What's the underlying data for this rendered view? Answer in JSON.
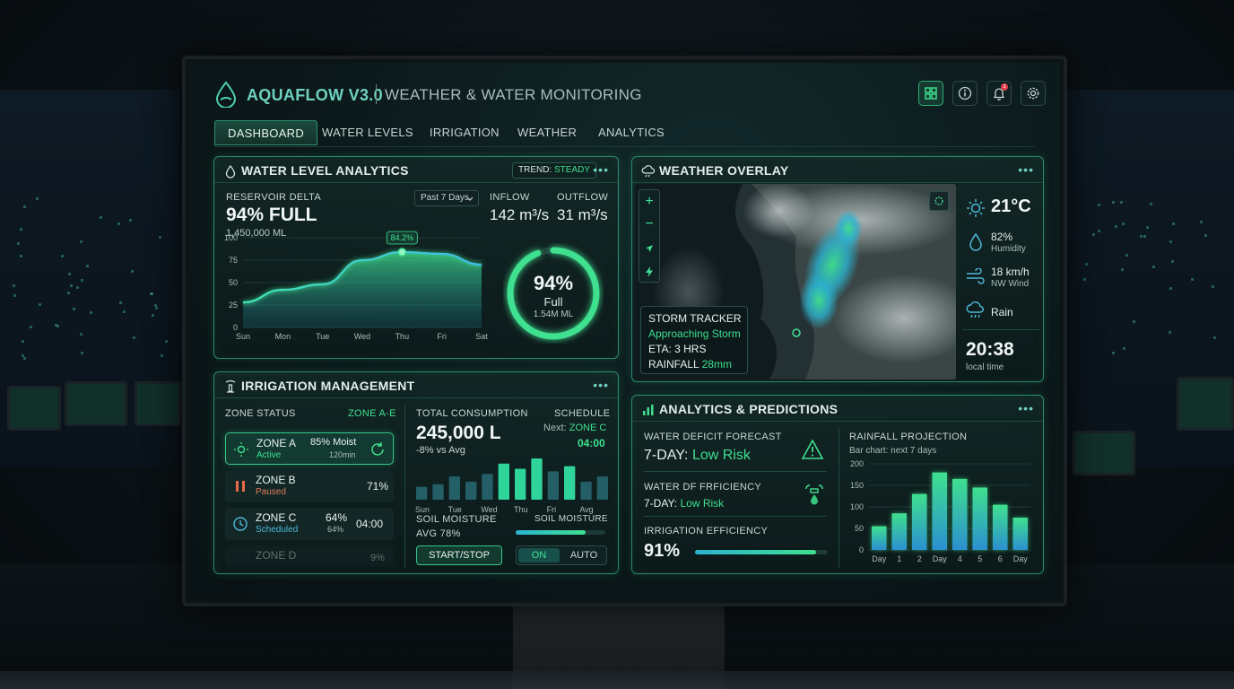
{
  "app": {
    "brand": "AQUAFLOW V3.0",
    "subtitle": "WEATHER & WATER MONITORING"
  },
  "header_buttons": [
    "grid-icon",
    "info-icon",
    "bell-icon",
    "gear-icon"
  ],
  "notification_count": "1",
  "tabs": [
    {
      "label": "DASHBOARD",
      "active": true
    },
    {
      "label": "WATER LEVELS"
    },
    {
      "label": "IRRIGATION"
    },
    {
      "label": "WEATHER"
    },
    {
      "label": "ANALYTICS"
    }
  ],
  "water": {
    "title": "WATER LEVEL ANALYTICS",
    "trend_label": "TREND:",
    "trend_value": "STEADY",
    "reservoir_label": "RESERVOIR DELTA",
    "reservoir_value": "94% FULL",
    "reservoir_volume": "1,450,000 ML",
    "range_select": "Past 7 Days",
    "inflow_label": "INFLOW",
    "inflow_value": "142 m³/s",
    "outflow_label": "OUTFLOW",
    "outflow_value": "31 m³/s",
    "gauge_percent": "94%",
    "gauge_fraction": 0.94,
    "gauge_label": "Full",
    "gauge_volume": "1.54M ML",
    "peak_label": "84.2%"
  },
  "chart_data": {
    "type": "area",
    "categories": [
      "Sun",
      "Mon",
      "Tue",
      "Wed",
      "Thu",
      "Fri",
      "Sat"
    ],
    "values": [
      28,
      42,
      48,
      75,
      84,
      82,
      70
    ],
    "yticks": [
      "100",
      "75",
      "50",
      "25",
      "0"
    ],
    "ylim": [
      0,
      100
    ],
    "annotation": "84.2%"
  },
  "weather": {
    "title": "WEATHER OVERLAY",
    "storm_title": "STORM TRACKER",
    "storm_status": "Approaching Storm",
    "storm_eta": "ETA: 3 HRS",
    "rainfall_label": "RAINFALL",
    "rainfall_value": "28mm",
    "temp": "21°C",
    "humidity_value": "82%",
    "humidity_label": "Humidity",
    "wind_value": "18 km/h",
    "wind_label": "NW Wind",
    "rain_label": "Rain",
    "time": "20:38",
    "time_label": "local time"
  },
  "irrigation": {
    "title": "IRRIGATION MANAGEMENT",
    "zone_status_label": "ZONE STATUS",
    "zone_range": "ZONE A-E",
    "zones": [
      {
        "name": "ZONE A",
        "state": "Active",
        "moist": "85% Moist",
        "time": "120min"
      },
      {
        "name": "ZONE B",
        "state": "Paused",
        "value": "71%"
      },
      {
        "name": "ZONE C",
        "state": "Scheduled",
        "value": "64%",
        "value2": "64%",
        "time": "04:00"
      },
      {
        "name": "ZONE D",
        "value": "9%"
      }
    ],
    "total_label": "TOTAL CONSUMPTION",
    "total_value": "245,000 L",
    "total_delta": "-8% vs Avg",
    "schedule_label": "SCHEDULE",
    "schedule_next": "Next:",
    "schedule_zone": "ZONE C",
    "schedule_time": "04:00",
    "bar_days": [
      "Sun",
      "Tue",
      "Wed",
      "Thu",
      "Fri",
      "Avg"
    ],
    "bar_values": [
      10,
      12,
      18,
      14,
      20,
      28,
      24,
      32,
      22,
      26,
      14,
      18
    ],
    "soil_label": "SOIL MOISTURE",
    "soil_avg": "AVG 78%",
    "soil_label2": "SOIL MOISTURE",
    "soil_fraction": 0.78,
    "start_stop": "START/STOP",
    "toggle_on": "ON",
    "toggle_auto": "AUTO"
  },
  "analytics": {
    "title": "ANALYTICS & PREDICTIONS",
    "deficit_label": "WATER DEFICIT FORECAST",
    "deficit_prefix": "7-DAY:",
    "deficit_value": "Low Risk",
    "eff_label": "WATER DF FRFICIENCY",
    "eff_prefix": "7-DAY:",
    "eff_value": "Low Risk",
    "irr_eff_label": "IRRIGATION EFFICIENCY",
    "irr_eff_value": "91%",
    "irr_eff_fraction": 0.91,
    "rain_title": "RAINFALL PROJECTION",
    "rain_sub": "Bar chart: next 7 days",
    "rain_yticks": [
      "200",
      "150",
      "100",
      "50",
      "0"
    ],
    "rain_categories": [
      "Day",
      "1",
      "2",
      "Day",
      "4",
      "5",
      "6",
      "Day"
    ],
    "rain_values": [
      55,
      85,
      130,
      180,
      165,
      145,
      105,
      75
    ]
  }
}
